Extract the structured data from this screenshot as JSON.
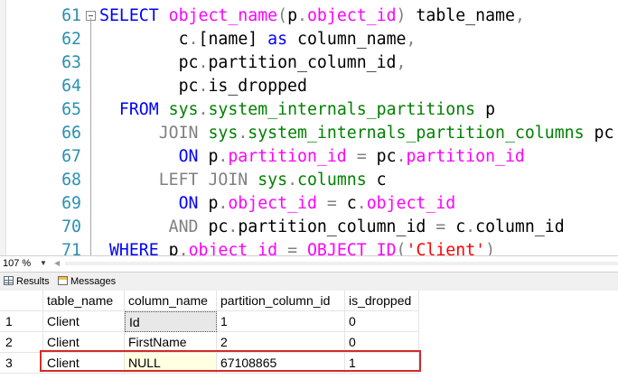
{
  "editor": {
    "lines": [
      {
        "num": "61",
        "tokens": [
          {
            "t": "SELECT ",
            "c": "kw"
          },
          {
            "t": "object_name",
            "c": "fn"
          },
          {
            "t": "(",
            "c": "gray"
          },
          {
            "t": "p",
            "c": "plain"
          },
          {
            "t": ".",
            "c": "gray"
          },
          {
            "t": "object_id",
            "c": "fn"
          },
          {
            "t": ")",
            "c": "gray"
          },
          {
            "t": " table_name",
            "c": "plain"
          },
          {
            "t": ",",
            "c": "gray"
          }
        ]
      },
      {
        "num": "62",
        "tokens": [
          {
            "t": "        c",
            "c": "plain"
          },
          {
            "t": ".",
            "c": "gray"
          },
          {
            "t": "[name] ",
            "c": "plain"
          },
          {
            "t": "as",
            "c": "kw"
          },
          {
            "t": " column_name",
            "c": "plain"
          },
          {
            "t": ",",
            "c": "gray"
          }
        ]
      },
      {
        "num": "63",
        "tokens": [
          {
            "t": "        pc",
            "c": "plain"
          },
          {
            "t": ".",
            "c": "gray"
          },
          {
            "t": "partition_column_id",
            "c": "plain"
          },
          {
            "t": ",",
            "c": "gray"
          }
        ]
      },
      {
        "num": "64",
        "tokens": [
          {
            "t": "        pc",
            "c": "plain"
          },
          {
            "t": ".",
            "c": "gray"
          },
          {
            "t": "is_dropped",
            "c": "plain"
          }
        ]
      },
      {
        "num": "65",
        "tokens": [
          {
            "t": "  FROM ",
            "c": "kw"
          },
          {
            "t": "sys",
            "c": "sys"
          },
          {
            "t": ".",
            "c": "gray"
          },
          {
            "t": "system_internals_partitions",
            "c": "sys"
          },
          {
            "t": " p",
            "c": "plain"
          }
        ]
      },
      {
        "num": "66",
        "tokens": [
          {
            "t": "      JOIN ",
            "c": "gray"
          },
          {
            "t": "sys",
            "c": "sys"
          },
          {
            "t": ".",
            "c": "gray"
          },
          {
            "t": "system_internals_partition_columns",
            "c": "sys"
          },
          {
            "t": " pc",
            "c": "plain"
          }
        ]
      },
      {
        "num": "67",
        "tokens": [
          {
            "t": "        ON ",
            "c": "kw"
          },
          {
            "t": "p",
            "c": "plain"
          },
          {
            "t": ".",
            "c": "gray"
          },
          {
            "t": "partition_id",
            "c": "fn"
          },
          {
            "t": " = ",
            "c": "gray"
          },
          {
            "t": "pc",
            "c": "plain"
          },
          {
            "t": ".",
            "c": "gray"
          },
          {
            "t": "partition_id",
            "c": "fn"
          }
        ]
      },
      {
        "num": "68",
        "tokens": [
          {
            "t": "      LEFT JOIN ",
            "c": "gray"
          },
          {
            "t": "sys",
            "c": "sys"
          },
          {
            "t": ".",
            "c": "gray"
          },
          {
            "t": "columns",
            "c": "sys"
          },
          {
            "t": " c",
            "c": "plain"
          }
        ]
      },
      {
        "num": "69",
        "tokens": [
          {
            "t": "        ON ",
            "c": "kw"
          },
          {
            "t": "p",
            "c": "plain"
          },
          {
            "t": ".",
            "c": "gray"
          },
          {
            "t": "object_id",
            "c": "fn"
          },
          {
            "t": " = ",
            "c": "gray"
          },
          {
            "t": "c",
            "c": "plain"
          },
          {
            "t": ".",
            "c": "gray"
          },
          {
            "t": "object_id",
            "c": "fn"
          }
        ]
      },
      {
        "num": "70",
        "tokens": [
          {
            "t": "       AND ",
            "c": "gray"
          },
          {
            "t": "pc",
            "c": "plain"
          },
          {
            "t": ".",
            "c": "gray"
          },
          {
            "t": "partition_column_id",
            "c": "plain"
          },
          {
            "t": " = ",
            "c": "gray"
          },
          {
            "t": "c",
            "c": "plain"
          },
          {
            "t": ".",
            "c": "gray"
          },
          {
            "t": "column_id",
            "c": "plain"
          }
        ]
      },
      {
        "num": "71",
        "tokens": [
          {
            "t": " WHERE ",
            "c": "kw"
          },
          {
            "t": "p",
            "c": "plain"
          },
          {
            "t": ".",
            "c": "gray"
          },
          {
            "t": "object_id",
            "c": "fn"
          },
          {
            "t": " = ",
            "c": "gray"
          },
          {
            "t": "OBJECT_ID",
            "c": "fn"
          },
          {
            "t": "(",
            "c": "gray"
          },
          {
            "t": "'Client'",
            "c": "str"
          },
          {
            "t": ")",
            "c": "gray"
          }
        ]
      }
    ]
  },
  "status": {
    "zoom": "107 %"
  },
  "tabs": {
    "results": "Results",
    "messages": "Messages"
  },
  "grid": {
    "headers": [
      "table_name",
      "column_name",
      "partition_column_id",
      "is_dropped"
    ],
    "rows": [
      {
        "n": "1",
        "cells": [
          "Client",
          "Id",
          "1",
          "0"
        ]
      },
      {
        "n": "2",
        "cells": [
          "Client",
          "FirstName",
          "2",
          "0"
        ]
      },
      {
        "n": "3",
        "cells": [
          "Client",
          "NULL",
          "67108865",
          "1"
        ]
      }
    ]
  },
  "colors": {
    "keyword": "#0000ff",
    "function": "#ff00ff",
    "system": "#008000",
    "string": "#ff0000",
    "operator": "#808080",
    "line_number": "#2b91af",
    "highlight": "#d42a2a"
  }
}
